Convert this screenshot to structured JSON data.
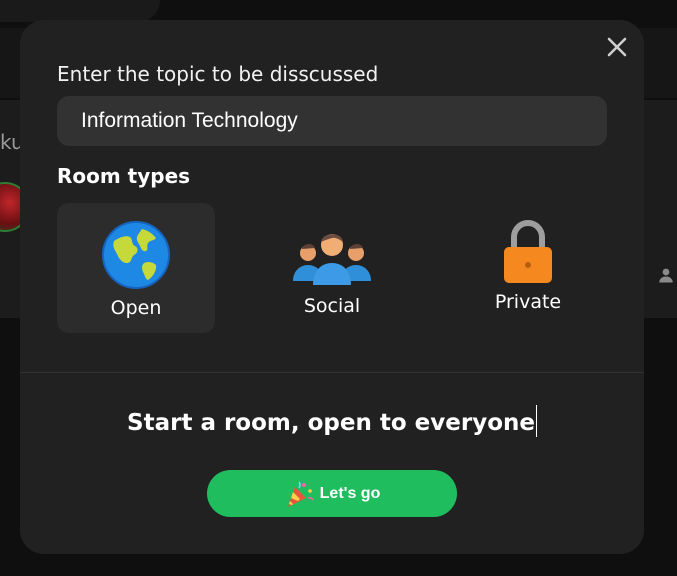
{
  "background": {
    "text_fragment": "ku"
  },
  "modal": {
    "topic_label": "Enter the topic to be disscussed",
    "topic_value": "Information Technology",
    "room_types_label": "Room types",
    "room_types": [
      {
        "label": "Open",
        "icon": "globe-icon",
        "selected": true
      },
      {
        "label": "Social",
        "icon": "people-group-icon",
        "selected": false
      },
      {
        "label": "Private",
        "icon": "lock-icon",
        "selected": false
      }
    ],
    "start_text": "Start a room, open to everyone",
    "go_button_label": "Let's go",
    "go_button_icon": "party-popper-icon"
  },
  "colors": {
    "modal_bg": "#212121",
    "input_bg": "#323232",
    "selected_option_bg": "#2c2c2c",
    "go_button": "#20bd5f",
    "lock": "#f5891f"
  }
}
